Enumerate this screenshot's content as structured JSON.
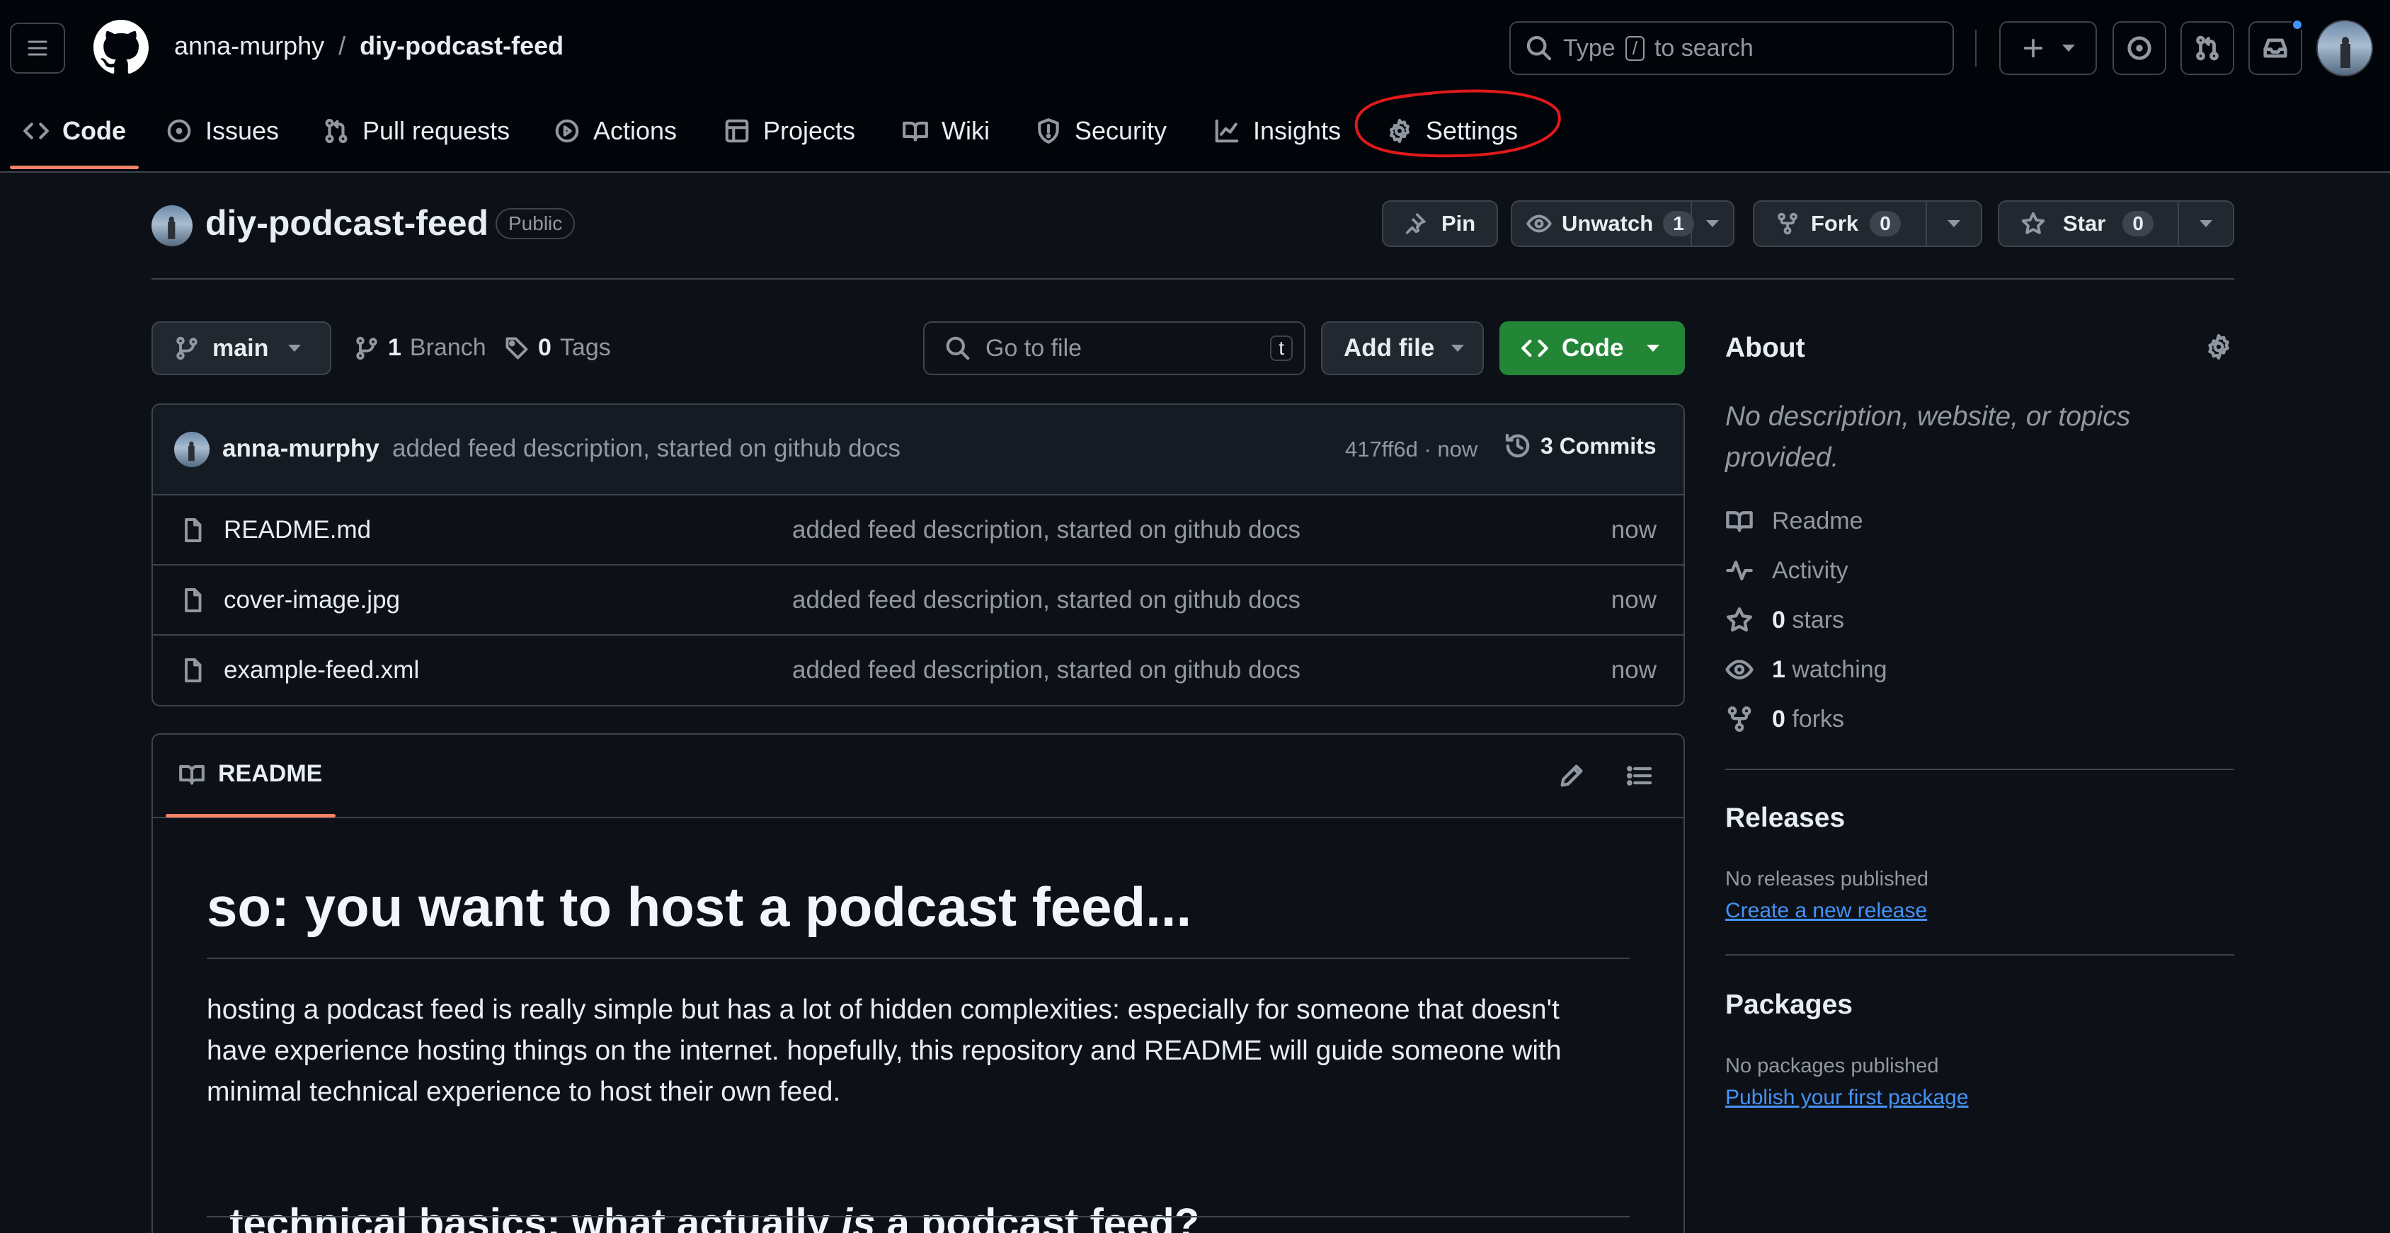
{
  "header": {
    "owner": "anna-murphy",
    "separator": "/",
    "repo": "diy-podcast-feed",
    "search_prefix": "Type",
    "search_key": "/",
    "search_suffix": "to search",
    "notification_dot_color": "#4493f8"
  },
  "tabs": [
    {
      "label": "Code",
      "icon": "code-icon",
      "selected": true
    },
    {
      "label": "Issues",
      "icon": "issue-opened-icon"
    },
    {
      "label": "Pull requests",
      "icon": "git-pull-request-icon"
    },
    {
      "label": "Actions",
      "icon": "play-icon"
    },
    {
      "label": "Projects",
      "icon": "table-icon"
    },
    {
      "label": "Wiki",
      "icon": "book-icon"
    },
    {
      "label": "Security",
      "icon": "shield-icon"
    },
    {
      "label": "Insights",
      "icon": "graph-icon"
    },
    {
      "label": "Settings",
      "icon": "gear-icon",
      "highlighted": true,
      "highlight_color": "#e0191b"
    }
  ],
  "repo_header": {
    "name": "diy-podcast-feed",
    "visibility": "Public",
    "pin_label": "Pin",
    "unwatch_label": "Unwatch",
    "watch_count": "1",
    "fork_label": "Fork",
    "fork_count": "0",
    "star_label": "Star",
    "star_count": "0"
  },
  "toolbar": {
    "branch": "main",
    "branch_count": "1",
    "branch_label": "Branch",
    "tag_count": "0",
    "tag_label": "Tags",
    "goto_placeholder": "Go to file",
    "goto_key": "t",
    "add_file_label": "Add file",
    "code_label": "Code",
    "code_button_color": "#238636"
  },
  "commit_bar": {
    "author": "anna-murphy",
    "message": "added feed description, started on github docs",
    "sha_time": "417ff6d · now",
    "commits_label": "3 Commits"
  },
  "files": [
    {
      "name": "README.md",
      "message": "added feed description, started on github docs",
      "time": "now"
    },
    {
      "name": "cover-image.jpg",
      "message": "added feed description, started on github docs",
      "time": "now"
    },
    {
      "name": "example-feed.xml",
      "message": "added feed description, started on github docs",
      "time": "now"
    }
  ],
  "readme": {
    "tab_label": "README",
    "h1": "so: you want to host a podcast feed...",
    "paragraph_lines": [
      "hosting a podcast feed is really simple but has a lot of hidden complexities: especially for someone that doesn't",
      "have experience hosting things on the internet. hopefully, this repository and README will guide someone with",
      "minimal technical experience to host their own feed."
    ],
    "h2_before": "technical basics: what actually ",
    "h2_em": "is",
    "h2_after": " a podcast feed?"
  },
  "about": {
    "title": "About",
    "description_line1": "No description, website, or topics",
    "description_line2": "provided.",
    "readme_label": "Readme",
    "activity_label": "Activity",
    "stars_count": "0",
    "stars_label": "stars",
    "watching_count": "1",
    "watching_label": "watching",
    "forks_count": "0",
    "forks_label": "forks"
  },
  "releases": {
    "title": "Releases",
    "empty_text": "No releases published",
    "create_link": "Create a new release"
  },
  "packages": {
    "title": "Packages",
    "empty_text": "No packages published",
    "publish_link": "Publish your first package"
  }
}
